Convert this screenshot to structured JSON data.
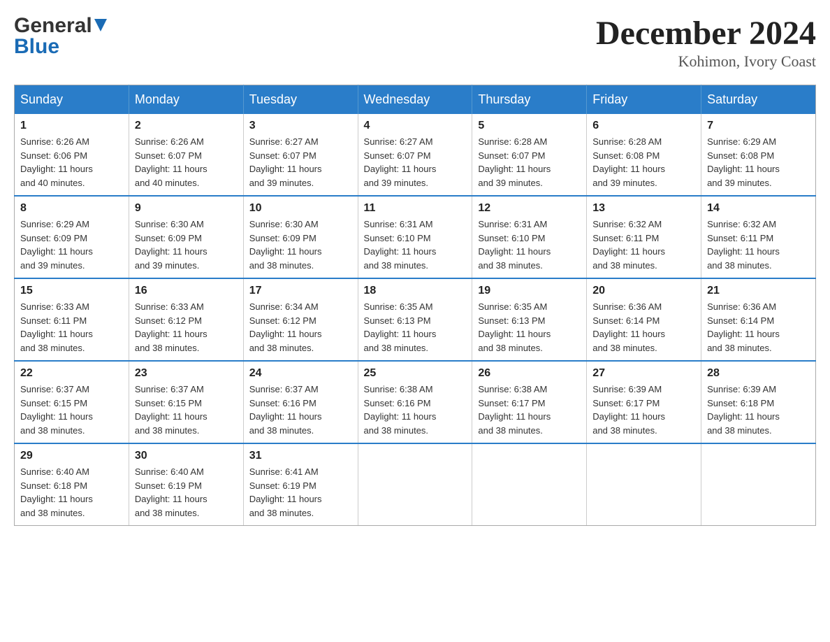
{
  "header": {
    "logo_general": "General",
    "logo_blue": "Blue",
    "month_title": "December 2024",
    "location": "Kohimon, Ivory Coast"
  },
  "days_of_week": [
    "Sunday",
    "Monday",
    "Tuesday",
    "Wednesday",
    "Thursday",
    "Friday",
    "Saturday"
  ],
  "weeks": [
    [
      {
        "day": "1",
        "sunrise": "6:26 AM",
        "sunset": "6:06 PM",
        "daylight": "11 hours and 40 minutes."
      },
      {
        "day": "2",
        "sunrise": "6:26 AM",
        "sunset": "6:07 PM",
        "daylight": "11 hours and 40 minutes."
      },
      {
        "day": "3",
        "sunrise": "6:27 AM",
        "sunset": "6:07 PM",
        "daylight": "11 hours and 39 minutes."
      },
      {
        "day": "4",
        "sunrise": "6:27 AM",
        "sunset": "6:07 PM",
        "daylight": "11 hours and 39 minutes."
      },
      {
        "day": "5",
        "sunrise": "6:28 AM",
        "sunset": "6:07 PM",
        "daylight": "11 hours and 39 minutes."
      },
      {
        "day": "6",
        "sunrise": "6:28 AM",
        "sunset": "6:08 PM",
        "daylight": "11 hours and 39 minutes."
      },
      {
        "day": "7",
        "sunrise": "6:29 AM",
        "sunset": "6:08 PM",
        "daylight": "11 hours and 39 minutes."
      }
    ],
    [
      {
        "day": "8",
        "sunrise": "6:29 AM",
        "sunset": "6:09 PM",
        "daylight": "11 hours and 39 minutes."
      },
      {
        "day": "9",
        "sunrise": "6:30 AM",
        "sunset": "6:09 PM",
        "daylight": "11 hours and 39 minutes."
      },
      {
        "day": "10",
        "sunrise": "6:30 AM",
        "sunset": "6:09 PM",
        "daylight": "11 hours and 38 minutes."
      },
      {
        "day": "11",
        "sunrise": "6:31 AM",
        "sunset": "6:10 PM",
        "daylight": "11 hours and 38 minutes."
      },
      {
        "day": "12",
        "sunrise": "6:31 AM",
        "sunset": "6:10 PM",
        "daylight": "11 hours and 38 minutes."
      },
      {
        "day": "13",
        "sunrise": "6:32 AM",
        "sunset": "6:11 PM",
        "daylight": "11 hours and 38 minutes."
      },
      {
        "day": "14",
        "sunrise": "6:32 AM",
        "sunset": "6:11 PM",
        "daylight": "11 hours and 38 minutes."
      }
    ],
    [
      {
        "day": "15",
        "sunrise": "6:33 AM",
        "sunset": "6:11 PM",
        "daylight": "11 hours and 38 minutes."
      },
      {
        "day": "16",
        "sunrise": "6:33 AM",
        "sunset": "6:12 PM",
        "daylight": "11 hours and 38 minutes."
      },
      {
        "day": "17",
        "sunrise": "6:34 AM",
        "sunset": "6:12 PM",
        "daylight": "11 hours and 38 minutes."
      },
      {
        "day": "18",
        "sunrise": "6:35 AM",
        "sunset": "6:13 PM",
        "daylight": "11 hours and 38 minutes."
      },
      {
        "day": "19",
        "sunrise": "6:35 AM",
        "sunset": "6:13 PM",
        "daylight": "11 hours and 38 minutes."
      },
      {
        "day": "20",
        "sunrise": "6:36 AM",
        "sunset": "6:14 PM",
        "daylight": "11 hours and 38 minutes."
      },
      {
        "day": "21",
        "sunrise": "6:36 AM",
        "sunset": "6:14 PM",
        "daylight": "11 hours and 38 minutes."
      }
    ],
    [
      {
        "day": "22",
        "sunrise": "6:37 AM",
        "sunset": "6:15 PM",
        "daylight": "11 hours and 38 minutes."
      },
      {
        "day": "23",
        "sunrise": "6:37 AM",
        "sunset": "6:15 PM",
        "daylight": "11 hours and 38 minutes."
      },
      {
        "day": "24",
        "sunrise": "6:37 AM",
        "sunset": "6:16 PM",
        "daylight": "11 hours and 38 minutes."
      },
      {
        "day": "25",
        "sunrise": "6:38 AM",
        "sunset": "6:16 PM",
        "daylight": "11 hours and 38 minutes."
      },
      {
        "day": "26",
        "sunrise": "6:38 AM",
        "sunset": "6:17 PM",
        "daylight": "11 hours and 38 minutes."
      },
      {
        "day": "27",
        "sunrise": "6:39 AM",
        "sunset": "6:17 PM",
        "daylight": "11 hours and 38 minutes."
      },
      {
        "day": "28",
        "sunrise": "6:39 AM",
        "sunset": "6:18 PM",
        "daylight": "11 hours and 38 minutes."
      }
    ],
    [
      {
        "day": "29",
        "sunrise": "6:40 AM",
        "sunset": "6:18 PM",
        "daylight": "11 hours and 38 minutes."
      },
      {
        "day": "30",
        "sunrise": "6:40 AM",
        "sunset": "6:19 PM",
        "daylight": "11 hours and 38 minutes."
      },
      {
        "day": "31",
        "sunrise": "6:41 AM",
        "sunset": "6:19 PM",
        "daylight": "11 hours and 38 minutes."
      },
      null,
      null,
      null,
      null
    ]
  ],
  "labels": {
    "sunrise": "Sunrise:",
    "sunset": "Sunset:",
    "daylight": "Daylight:"
  },
  "colors": {
    "header_bg": "#2a7dc9",
    "border_accent": "#2a7dc9"
  }
}
